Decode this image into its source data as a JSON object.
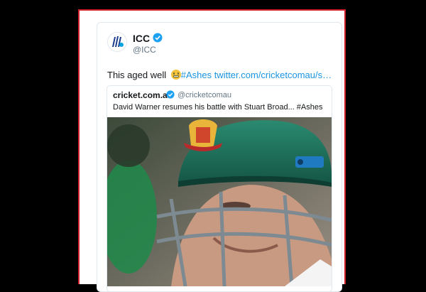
{
  "tweet": {
    "author_name": "ICC",
    "author_handle": "@ICC",
    "text_plain": "This aged well ",
    "emoji": "grinning-face-emoji",
    "text_links": "#Ashes twitter.com/cricketcomau/s…",
    "quoted": {
      "author_name": "cricket.com.au",
      "author_handle": "@cricketcomau",
      "text": "David Warner resumes his battle with Stuart Broad... #Ashes",
      "image": "cricketer-in-green-helmet-photo"
    }
  },
  "colors": {
    "frame_border": "#d0202a",
    "link": "#1b95e0",
    "verified": "#1da1f2",
    "helmet_green": "#1f6b58"
  }
}
